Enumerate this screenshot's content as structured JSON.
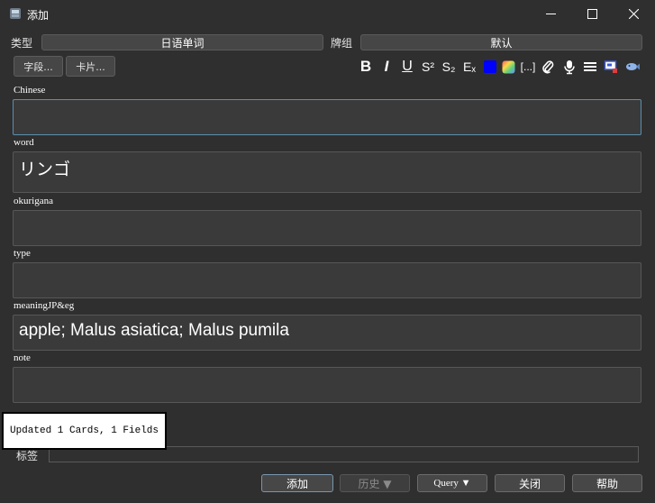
{
  "window": {
    "title": "添加"
  },
  "header": {
    "type_label": "类型",
    "type_value": "日语单词",
    "deck_label": "牌组",
    "deck_value": "默认"
  },
  "toolbar": {
    "fields_button": "字段...",
    "cards_button": "卡片...",
    "bold": "B",
    "italic": "I",
    "underline": "U",
    "superscript": "S²",
    "subscript": "S₂",
    "clear_format": "Eₓ",
    "cloze": "[...]",
    "text_color": "#0000ff"
  },
  "fields": [
    {
      "label": "Chinese",
      "value": ""
    },
    {
      "label": "word",
      "value": "リンゴ"
    },
    {
      "label": "okurigana",
      "value": ""
    },
    {
      "label": "type",
      "value": ""
    },
    {
      "label": "meaningJP&eg",
      "value": "apple; Malus asiatica; Malus pumila"
    },
    {
      "label": "note",
      "value": ""
    }
  ],
  "tooltip": "Updated 1 Cards, 1 Fields",
  "tags": {
    "label": "标签",
    "value": ""
  },
  "buttons": {
    "add": "添加",
    "history": "历史 ▼",
    "query": "Query ▼",
    "close": "关闭",
    "help": "帮助"
  }
}
